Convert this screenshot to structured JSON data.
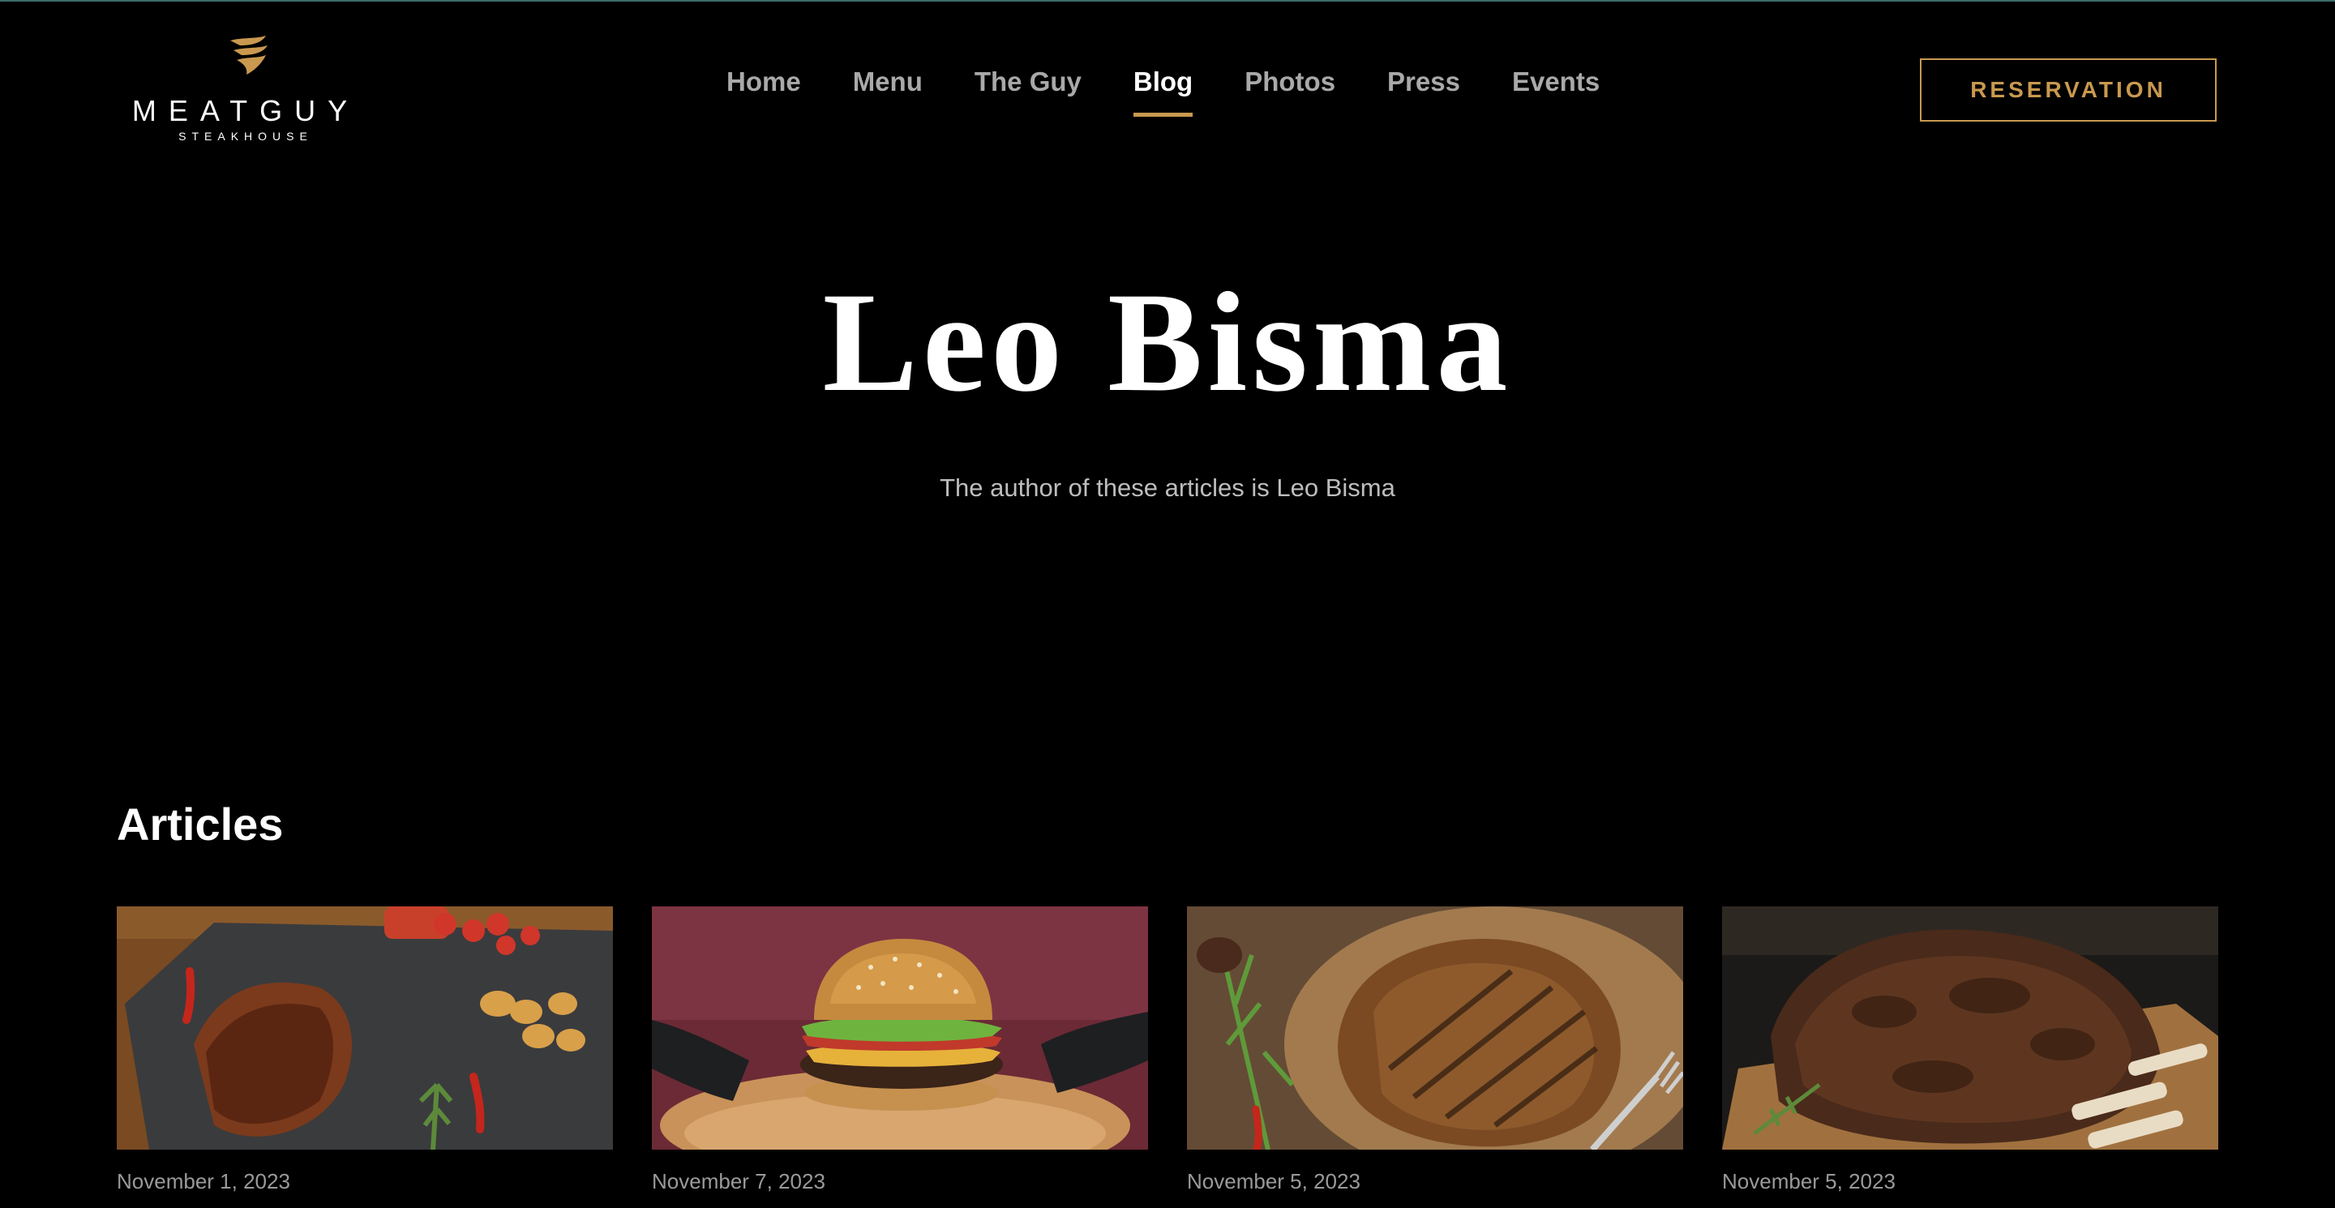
{
  "brand": {
    "name": "MEATGUY",
    "tagline": "STEAKHOUSE"
  },
  "nav": {
    "items": [
      {
        "label": "Home"
      },
      {
        "label": "Menu"
      },
      {
        "label": "The Guy"
      },
      {
        "label": "Blog",
        "active": true
      },
      {
        "label": "Photos"
      },
      {
        "label": "Press"
      },
      {
        "label": "Events"
      }
    ]
  },
  "reservation_label": "RESERVATION",
  "hero": {
    "title": "Leo Bisma",
    "subtitle": "The author of these articles is Leo Bisma"
  },
  "articles": {
    "heading": "Articles",
    "items": [
      {
        "date": "November 1, 2023",
        "image": "ribs-on-slate"
      },
      {
        "date": "November 7, 2023",
        "image": "burger-on-board"
      },
      {
        "date": "November 5, 2023",
        "image": "grilled-steak"
      },
      {
        "date": "November 5, 2023",
        "image": "prime-rib-roast"
      }
    ]
  },
  "colors": {
    "accent": "#c9994f",
    "background": "#000000",
    "nav_inactive": "#a9a9a9"
  }
}
